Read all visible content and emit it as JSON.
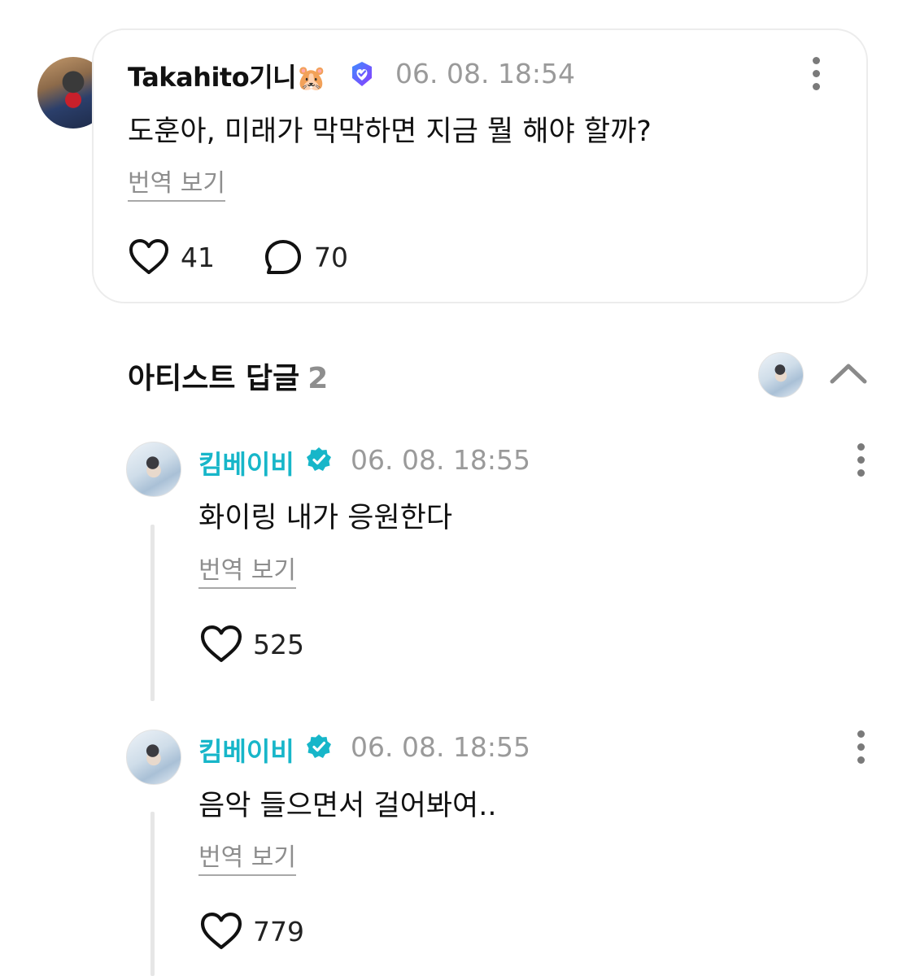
{
  "post": {
    "username": "Takahito기니",
    "emoji": "🐹",
    "timestamp": "06. 08. 18:54",
    "text": "도훈아, 미래가 막막하면 지금 뭘 해야 할까?",
    "translate_label": "번역 보기",
    "like_count": "41",
    "comment_count": "70"
  },
  "artist_replies_section": {
    "title": "아티스트 답글",
    "count": "2"
  },
  "replies": [
    {
      "username": "킴베이비",
      "timestamp": "06. 08. 18:55",
      "text": "화이링 내가 응원한다",
      "translate_label": "번역 보기",
      "like_count": "525"
    },
    {
      "username": "킴베이비",
      "timestamp": "06. 08. 18:55",
      "text": "음악 들으면서 걸어봐여..",
      "translate_label": "번역 보기",
      "like_count": "779"
    }
  ],
  "colors": {
    "artist_name": "#17b6c9",
    "fan_badge": "#6b5bff",
    "muted": "#9a9a9a"
  },
  "icons": {
    "like": "heart-outline-icon",
    "comment": "speech-bubble-icon",
    "more": "vertical-ellipsis-icon",
    "collapse": "chevron-up-icon",
    "fan_badge": "check-heart-badge-icon",
    "verified": "verified-check-badge-icon"
  }
}
